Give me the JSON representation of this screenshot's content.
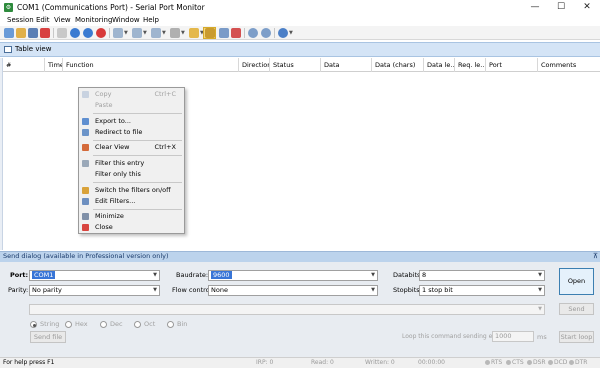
{
  "window": {
    "title": "COM1 (Communications Port) - Serial Port Monitor",
    "controls": [
      "—",
      "☐",
      "✕"
    ]
  },
  "menu": [
    "Session",
    "Edit",
    "View",
    "Monitoring",
    "Window",
    "Help"
  ],
  "table_view": {
    "title": "Table view",
    "columns": [
      "#",
      "Time",
      "Function",
      "Direction",
      "Status",
      "Data",
      "Data (chars)",
      "Data le...",
      "Req. le...",
      "Port",
      "Comments"
    ]
  },
  "context_menu": {
    "items": [
      {
        "label": "Copy",
        "shortcut": "Ctrl+C",
        "icon": "copy-icon",
        "enabled": false
      },
      {
        "label": "Paste",
        "shortcut": "",
        "icon": "paste-icon",
        "enabled": false
      },
      {
        "label": "Export to...",
        "shortcut": "",
        "icon": "export-icon",
        "enabled": true
      },
      {
        "label": "Redirect to file",
        "shortcut": "",
        "icon": "redirect-icon",
        "enabled": true
      },
      {
        "label": "Clear View",
        "shortcut": "Ctrl+X",
        "icon": "clear-view-icon",
        "enabled": true
      },
      {
        "label": "Filter this entry",
        "shortcut": "",
        "icon": "filter-icon",
        "enabled": true
      },
      {
        "label": "Filter only this",
        "shortcut": "",
        "icon": "",
        "enabled": true
      },
      {
        "label": "Switch the filters on/off",
        "shortcut": "",
        "icon": "filter-toggle-icon",
        "enabled": true
      },
      {
        "label": "Edit Filters...",
        "shortcut": "",
        "icon": "edit-filters-icon",
        "enabled": true
      },
      {
        "label": "Minimize",
        "shortcut": "",
        "icon": "minimize-icon",
        "enabled": true
      },
      {
        "label": "Close",
        "shortcut": "",
        "icon": "close-icon",
        "enabled": true
      }
    ]
  },
  "send_dialog": {
    "title": "Send dialog (available in Professional version only)",
    "pin": "⊼",
    "port_label": "Port:",
    "port_value": "COM1",
    "parity_label": "Parity:",
    "parity_value": "No parity",
    "baudrate_label": "Baudrate:",
    "baudrate_value": "9600",
    "flow_label": "Flow control:",
    "flow_value": "None",
    "databits_label": "Databits:",
    "databits_value": "8",
    "stopbits_label": "Stopbits:",
    "stopbits_value": "1 stop bit",
    "open_button": "Open",
    "send_button": "Send",
    "send_file_button": "Send file",
    "start_loop_button": "Start loop",
    "formats": [
      "String",
      "Hex",
      "Dec",
      "Oct",
      "Bin"
    ],
    "selected_format": "String",
    "loop_label": "Loop this command sending every",
    "loop_value": "1000",
    "loop_unit": "ms"
  },
  "status_bar": {
    "help": "For help press F1",
    "irp": "IRP: 0",
    "read": "Read: 0",
    "written": "Written: 0",
    "time": "00:00:00",
    "signals": [
      "RTS",
      "CTS",
      "DSR",
      "DCD",
      "DTR"
    ]
  },
  "colors": {
    "accent": "#3875d7",
    "panel_header": "#bcd3ec",
    "tableview_header": "#d4e4f6"
  }
}
